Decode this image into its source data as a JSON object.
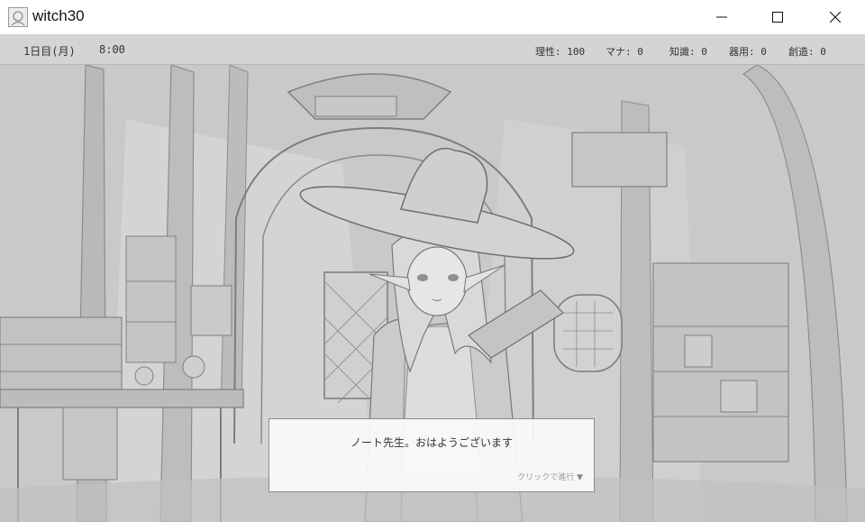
{
  "window": {
    "title": "witch30",
    "icon": "app-icon"
  },
  "window_controls": {
    "minimize": "minimize-icon",
    "maximize": "maximize-icon",
    "close": "close-icon"
  },
  "status": {
    "day": "1日目(月)",
    "time": "8:00",
    "stats": [
      {
        "label": "理性: 100"
      },
      {
        "label": "マナ: 0"
      },
      {
        "label": "知識: 0"
      },
      {
        "label": "器用: 0"
      },
      {
        "label": "創造: 0"
      }
    ]
  },
  "dialog": {
    "text": "ノート先生。おはようございます",
    "hint": "クリックで進行",
    "arrow": "▼"
  }
}
